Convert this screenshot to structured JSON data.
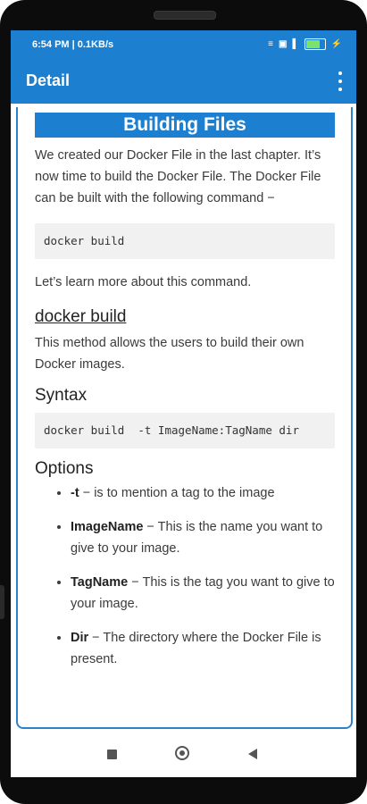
{
  "status": {
    "time": "6:54 PM | 0.1KB/s",
    "icons": [
      "wifi-icon",
      "sim-icon",
      "signal-icon",
      "battery-icon",
      "charging-icon"
    ],
    "battery_level": 0.7
  },
  "appbar": {
    "title": "Detail"
  },
  "article": {
    "heading": "Building Files",
    "intro": "We created our Docker File in the last chapter. It’s now time to build the Docker File. The Docker File can be built with the following command −",
    "code1": "docker build",
    "learn_more": "Let’s learn more about this command.",
    "subheading": "docker build",
    "description": "This method allows the users to build their own Docker images.",
    "syntax_label": "Syntax",
    "syntax_code": "docker build  -t ImageName:TagName dir",
    "options_label": "Options",
    "options": [
      {
        "term": "-t",
        "text": " − is to mention a tag to the image"
      },
      {
        "term": "ImageName",
        "text": " − This is the name you want to give to your image."
      },
      {
        "term": "TagName",
        "text": " − This is the tag you want to give to your image."
      },
      {
        "term": "Dir",
        "text": " − The directory where the Docker File is present."
      }
    ]
  },
  "colors": {
    "primary": "#1c7fd0",
    "card_border": "#2e82c9",
    "code_bg": "#f1f1f1"
  }
}
